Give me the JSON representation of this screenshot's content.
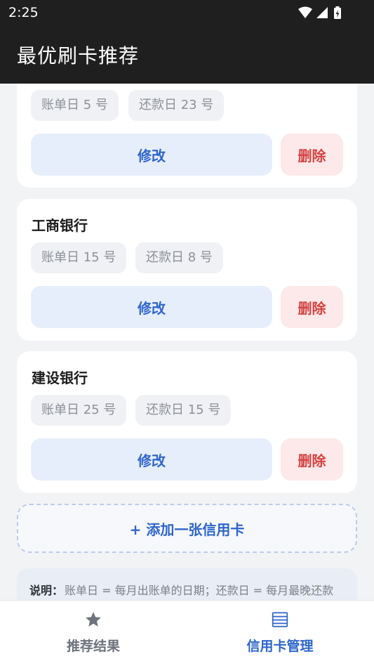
{
  "status_bar": {
    "time": "2:25"
  },
  "app_bar": {
    "title": "最优刷卡推荐"
  },
  "cards": [
    {
      "bank": "",
      "bill_day": "账单日 5 号",
      "due_day": "还款日 23 号",
      "edit_label": "修改",
      "delete_label": "删除"
    },
    {
      "bank": "工商银行",
      "bill_day": "账单日 15 号",
      "due_day": "还款日 8 号",
      "edit_label": "修改",
      "delete_label": "删除"
    },
    {
      "bank": "建设银行",
      "bill_day": "账单日 25 号",
      "due_day": "还款日 15 号",
      "edit_label": "修改",
      "delete_label": "删除"
    }
  ],
  "add_card_label": "+ 添加一张信用卡",
  "note": {
    "label": "说明：",
    "text": "账单日 = 每月出账单的日期；还款日 = 每月最晚还款"
  },
  "bottom_nav": {
    "items": [
      {
        "label": "推荐结果",
        "icon": "star-icon",
        "active": false
      },
      {
        "label": "信用卡管理",
        "icon": "list-icon",
        "active": true
      }
    ]
  },
  "colors": {
    "accent": "#2f66cc",
    "danger": "#d64141",
    "inactive": "#6e737c",
    "app_bar": "#1f1f1f"
  }
}
